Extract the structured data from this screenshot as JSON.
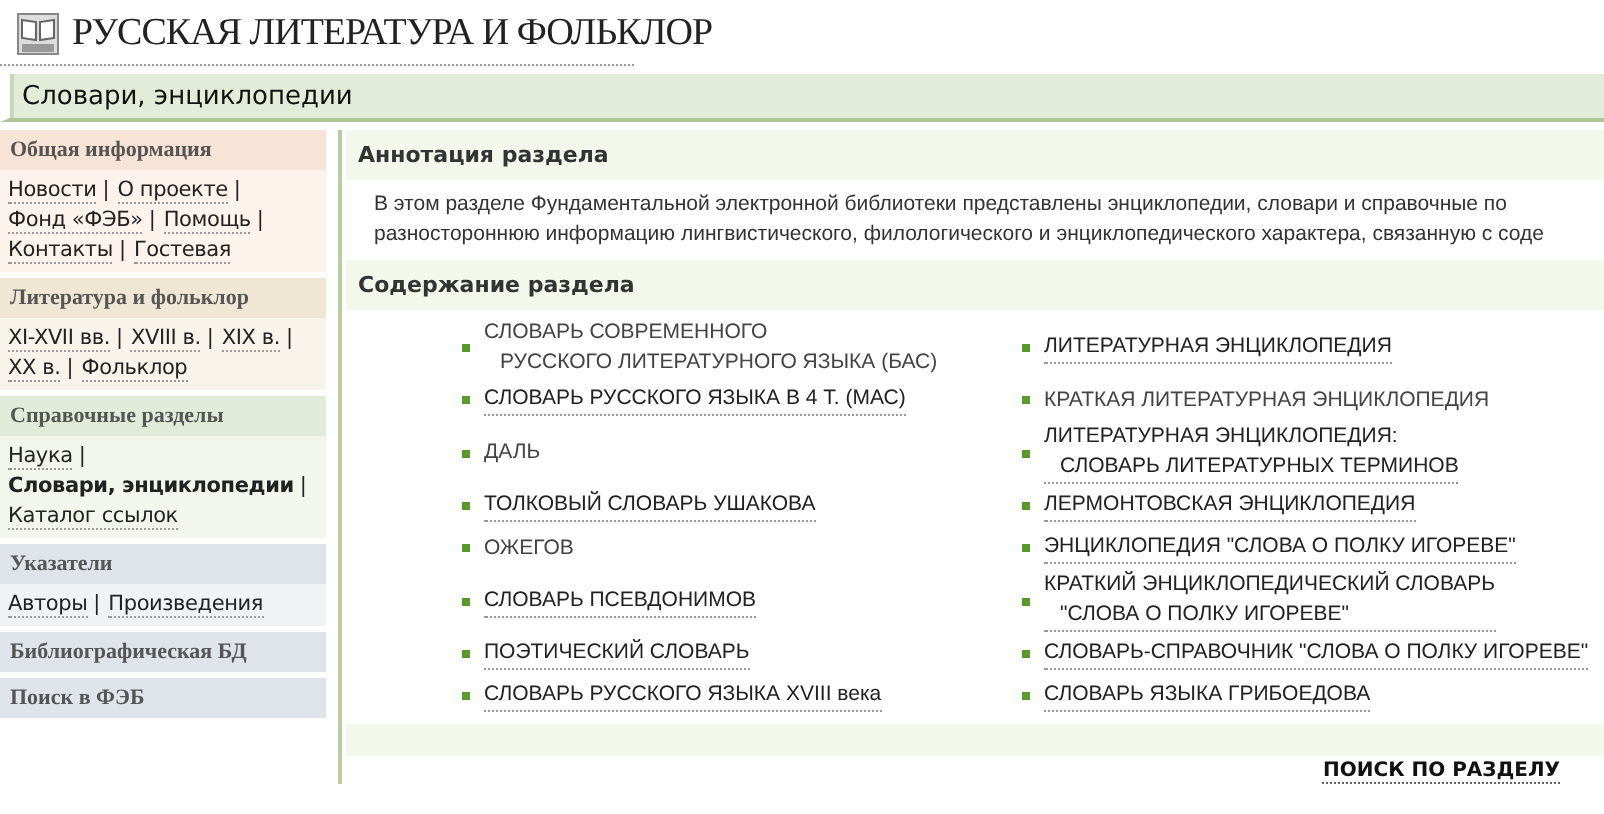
{
  "header": {
    "title": "РУССКАЯ ЛИТЕРАТУРА И ФОЛЬКЛОР"
  },
  "breadcrumb": "Словари, энциклопедии",
  "sidebar": [
    {
      "title": "Общая информация",
      "color": "#f8e4d6",
      "links": [
        {
          "label": "Новости",
          "sep": "|",
          "selected": false
        },
        {
          "label": "О проекте",
          "sep": "|",
          "selected": false
        },
        {
          "label": "Фонд «ФЭБ»",
          "sep": "|",
          "selected": false
        },
        {
          "label": "Помощь",
          "sep": "|",
          "selected": false
        },
        {
          "label": "Контакты",
          "sep": "|",
          "selected": false
        },
        {
          "label": "Гостевая",
          "selected": false
        }
      ]
    },
    {
      "title": "Литература и фольклор",
      "color": "#efe6d4",
      "links": [
        {
          "label": "XI-XVII вв.",
          "sep": "|",
          "selected": false
        },
        {
          "label": "XVIII в.",
          "sep": "|",
          "selected": false
        },
        {
          "label": "XIX в.",
          "sep": "|",
          "selected": false
        },
        {
          "label": "XX в.",
          "sep": "|",
          "selected": false
        },
        {
          "label": "Фольклор",
          "selected": false
        }
      ]
    },
    {
      "title": "Справочные разделы",
      "color": "#e1ecd8",
      "links": [
        {
          "label": "Наука",
          "sep": "|",
          "selected": false
        },
        {
          "label": "Словари, энциклопедии",
          "sep": "|",
          "selected": true
        },
        {
          "label": "Каталог ссылок",
          "selected": false
        }
      ]
    },
    {
      "title": "Указатели",
      "color": "#dfe3ea",
      "links": [
        {
          "label": "Авторы",
          "sep": "|",
          "selected": false
        },
        {
          "label": "Произведения",
          "selected": false
        }
      ]
    },
    {
      "title": "Библиографическая БД",
      "color": "#dfe3ea"
    },
    {
      "title": "Поиск в ФЭБ",
      "color": "#dfe3ea"
    }
  ],
  "annotation": {
    "title": "Аннотация раздела",
    "lines": [
      "В этом разделе Фундаментальной электронной библиотеки представлены энциклопедии, словари и справочные по",
      "разностороннюю информацию лингвистического, филологического и энциклопедического характера, связанную с соде"
    ]
  },
  "contents": {
    "title": "Содержание раздела",
    "rows": [
      {
        "left": {
          "lines": [
            "СЛОВАРЬ СОВРЕМЕННОГО",
            "РУССКОГО ЛИТЕРАТУРНОГО ЯЗЫКА (БАС)"
          ],
          "linked": false
        },
        "right": {
          "lines": [
            "ЛИТЕРАТУРНАЯ ЭНЦИКЛОПЕДИЯ"
          ],
          "linked": true
        }
      },
      {
        "left": {
          "lines": [
            "СЛОВАРЬ РУССКОГО ЯЗЫКА В 4 Т. (МАС)"
          ],
          "linked": true
        },
        "right": {
          "lines": [
            "КРАТКАЯ ЛИТЕРАТУРНАЯ ЭНЦИКЛОПЕДИЯ"
          ],
          "linked": false
        }
      },
      {
        "left": {
          "lines": [
            "ДАЛЬ"
          ],
          "linked": false
        },
        "right": {
          "lines": [
            "ЛИТЕРАТУРНАЯ ЭНЦИКЛОПЕДИЯ:",
            "СЛОВАРЬ ЛИТЕРАТУРНЫХ ТЕРМИНОВ"
          ],
          "linked": true
        }
      },
      {
        "left": {
          "lines": [
            "ТОЛКОВЫЙ СЛОВАРЬ УШАКОВА"
          ],
          "linked": true
        },
        "right": {
          "lines": [
            "ЛЕРМОНТОВСКАЯ ЭНЦИКЛОПЕДИЯ"
          ],
          "linked": true
        }
      },
      {
        "left": {
          "lines": [
            "ОЖЕГОВ"
          ],
          "linked": false
        },
        "right": {
          "lines": [
            "ЭНЦИКЛОПЕДИЯ \"СЛОВА О ПОЛКУ ИГОРЕВЕ\""
          ],
          "linked": true
        }
      },
      {
        "left": {
          "lines": [
            "СЛОВАРЬ ПСЕВДОНИМОВ"
          ],
          "linked": true
        },
        "right": {
          "lines": [
            "КРАТКИЙ ЭНЦИКЛОПЕДИЧЕСКИЙ СЛОВАРЬ",
            "\"СЛОВА О ПОЛКУ ИГОРЕВЕ\""
          ],
          "linked": true
        }
      },
      {
        "left": {
          "lines": [
            "ПОЭТИЧЕСКИЙ СЛОВАРЬ"
          ],
          "linked": true
        },
        "right": {
          "lines": [
            "СЛОВАРЬ-СПРАВОЧНИК \"СЛОВА О ПОЛКУ ИГОРЕВЕ\""
          ],
          "linked": true
        }
      },
      {
        "left": {
          "lines": [
            "СЛОВАРЬ РУССКОГО ЯЗЫКА XVIII века"
          ],
          "linked": true
        },
        "right": {
          "lines": [
            "СЛОВАРЬ ЯЗЫКА ГРИБОЕДОВА"
          ],
          "linked": true
        }
      }
    ]
  },
  "search_link": "ПОИСК ПО РАЗДЕЛУ"
}
